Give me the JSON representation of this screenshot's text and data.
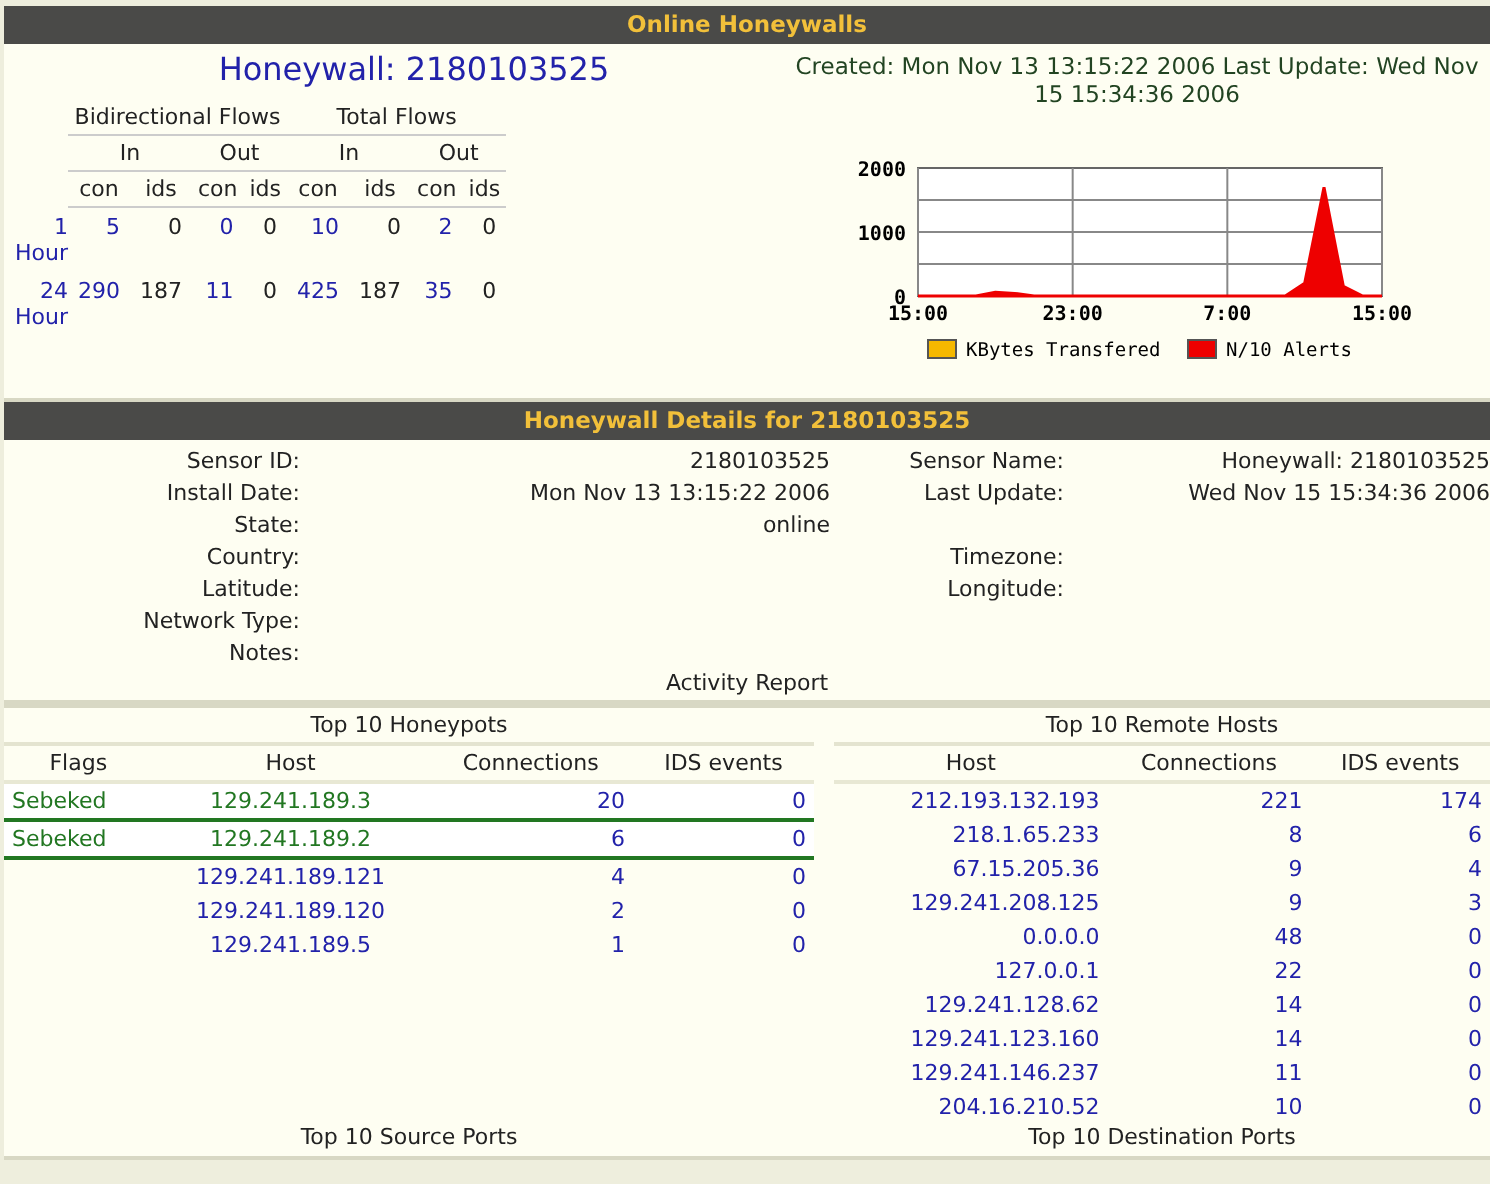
{
  "online": {
    "header": "Online Honeywalls",
    "title": "Honeywall: 2180103525",
    "created": "Created: Mon Nov 13 13:15:22 2006 Last Update: Wed Nov 15 15:34:36 2006",
    "flows": {
      "groups": [
        "Bidirectional Flows",
        "Total Flows"
      ],
      "directions": [
        "In",
        "Out",
        "In",
        "Out"
      ],
      "subcolumns": [
        {
          "label": "con",
          "kind": "link"
        },
        {
          "label": "ids",
          "kind": "plain"
        },
        {
          "label": "con",
          "kind": "link"
        },
        {
          "label": "ids",
          "kind": "plain"
        },
        {
          "label": "con",
          "kind": "link"
        },
        {
          "label": "ids",
          "kind": "plain"
        },
        {
          "label": "con",
          "kind": "link"
        },
        {
          "label": "ids",
          "kind": "plain"
        }
      ],
      "rows": [
        {
          "label": "1 Hour",
          "values": [
            "5",
            "0",
            "0",
            "0",
            "10",
            "0",
            "2",
            "0"
          ]
        },
        {
          "label": "24 Hour",
          "values": [
            "290",
            "187",
            "11",
            "0",
            "425",
            "187",
            "35",
            "0"
          ]
        }
      ]
    },
    "chart_data": {
      "type": "area",
      "categories": [
        "15:00",
        null,
        null,
        null,
        null,
        null,
        null,
        null,
        "23:00",
        null,
        null,
        null,
        null,
        null,
        null,
        null,
        "7:00",
        null,
        null,
        null,
        null,
        null,
        null,
        null,
        "15:00"
      ],
      "yticks": [
        0,
        1000,
        2000
      ],
      "ylim": [
        0,
        2000
      ],
      "grid": true,
      "series": [
        {
          "name": "KBytes Transfered",
          "color": "#f5b800",
          "values": [
            null,
            null,
            null,
            null,
            null,
            null,
            null,
            null,
            null,
            null,
            null,
            null,
            null,
            null,
            null,
            null,
            null,
            null,
            null,
            null,
            null,
            null,
            null,
            null,
            null
          ]
        },
        {
          "name": "N/10 Alerts",
          "color": "#ee0000",
          "values": [
            0,
            0,
            0,
            0,
            60,
            40,
            0,
            0,
            0,
            0,
            0,
            0,
            0,
            0,
            0,
            0,
            0,
            0,
            0,
            0,
            200,
            1700,
            150,
            0,
            0
          ]
        }
      ]
    }
  },
  "details": {
    "header": "Honeywall Details for 2180103525",
    "rows": [
      {
        "left": {
          "label": "Sensor ID:",
          "value": "2180103525"
        },
        "right": {
          "label": "Sensor Name:",
          "value": "Honeywall: 2180103525"
        }
      },
      {
        "left": {
          "label": "Install Date:",
          "value": "Mon Nov 13 13:15:22 2006"
        },
        "right": {
          "label": "Last Update:",
          "value": "Wed Nov 15 15:34:36 2006"
        }
      },
      {
        "left": {
          "label": "State:",
          "value": "online"
        }
      },
      {
        "left": {
          "label": "Country:"
        },
        "right": {
          "label": "Timezone:"
        }
      },
      {
        "left": {
          "label": "Latitude:"
        },
        "right": {
          "label": "Longitude:"
        }
      },
      {
        "left": {
          "label": "Network Type:"
        }
      },
      {
        "left": {
          "label": "Notes:"
        }
      }
    ],
    "activity": "Activity Report"
  },
  "honeypots": {
    "title": "Top 10 Honeypots",
    "columns": [
      "Flags",
      "Host",
      "Connections",
      "IDS events"
    ],
    "rows": [
      {
        "flag": "Sebeked",
        "host": "129.241.189.3",
        "connections": "20",
        "ids": "0",
        "highlighted": true
      },
      {
        "flag": "Sebeked",
        "host": "129.241.189.2",
        "connections": "6",
        "ids": "0",
        "highlighted": true
      },
      {
        "host": "129.241.189.121",
        "connections": "4",
        "ids": "0",
        "highlighted": false
      },
      {
        "host": "129.241.189.120",
        "connections": "2",
        "ids": "0",
        "highlighted": false
      },
      {
        "host": "129.241.189.5",
        "connections": "1",
        "ids": "0",
        "highlighted": false
      }
    ]
  },
  "remote_hosts": {
    "title": "Top 10 Remote Hosts",
    "columns": [
      "Host",
      "Connections",
      "IDS events"
    ],
    "rows": [
      [
        "212.193.132.193",
        "221",
        "174"
      ],
      [
        "218.1.65.233",
        "8",
        "6"
      ],
      [
        "67.15.205.36",
        "9",
        "4"
      ],
      [
        "129.241.208.125",
        "9",
        "3"
      ],
      [
        "0.0.0.0",
        "48",
        "0"
      ],
      [
        "127.0.0.1",
        "22",
        "0"
      ],
      [
        "129.241.128.62",
        "14",
        "0"
      ],
      [
        "129.241.123.160",
        "14",
        "0"
      ],
      [
        "129.241.146.237",
        "11",
        "0"
      ],
      [
        "204.16.210.52",
        "10",
        "0"
      ]
    ]
  },
  "source_ports": {
    "title": "Top 10 Source Ports"
  },
  "destination_ports": {
    "title": "Top 10 Destination Ports"
  }
}
